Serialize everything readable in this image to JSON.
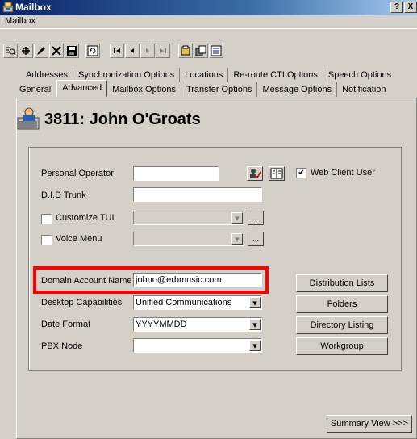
{
  "window": {
    "title": "Mailbox",
    "help_label": "?",
    "close_label": "X"
  },
  "menu": {
    "items": [
      "Mailbox"
    ]
  },
  "toolbar": {
    "buttons": [
      "find-icon",
      "add-icon",
      "edit-icon",
      "delete-icon",
      "save-icon",
      "refresh-icon",
      "first-icon",
      "previous-icon",
      "next-icon",
      "last-icon",
      "folder-icon",
      "copy-icon",
      "view-icon"
    ]
  },
  "tabs": {
    "row1": [
      "Addresses",
      "Synchronization Options",
      "Locations",
      "Re-route CTI Options",
      "Speech Options"
    ],
    "row2": [
      "General",
      "Advanced",
      "Mailbox Options",
      "Transfer Options",
      "Message Options",
      "Notification"
    ],
    "active": "Advanced"
  },
  "mailbox": {
    "heading": "3811: John O'Groats"
  },
  "form": {
    "personal_operator": {
      "label": "Personal Operator",
      "value": ""
    },
    "did_trunk": {
      "label": "D.I.D Trunk",
      "value": ""
    },
    "customize_tui": {
      "label": "Customize TUI",
      "checked": false,
      "value": ""
    },
    "voice_menu": {
      "label": "Voice Menu",
      "checked": false,
      "value": ""
    },
    "web_client_user": {
      "label": "Web Client User",
      "checked": true,
      "check_mark": "✔"
    },
    "domain_account_name": {
      "label": "Domain Account Name",
      "value": "johno@erbmusic.com"
    },
    "desktop_capabilities": {
      "label": "Desktop Capabilities",
      "value": "Unified Communications"
    },
    "date_format": {
      "label": "Date Format",
      "value": "YYYYMMDD"
    },
    "pbx_node": {
      "label": "PBX Node",
      "value": ""
    },
    "ellipsis": "..."
  },
  "side_buttons": {
    "distribution_lists": "Distribution Lists",
    "folders": "Folders",
    "directory_listing": "Directory Listing",
    "workgroup": "Workgroup"
  },
  "footer": {
    "summary_view": "Summary View >>>"
  },
  "colors": {
    "highlight": "#ff0000",
    "titlebar": "#0a246a",
    "face": "#d4d0c8"
  }
}
